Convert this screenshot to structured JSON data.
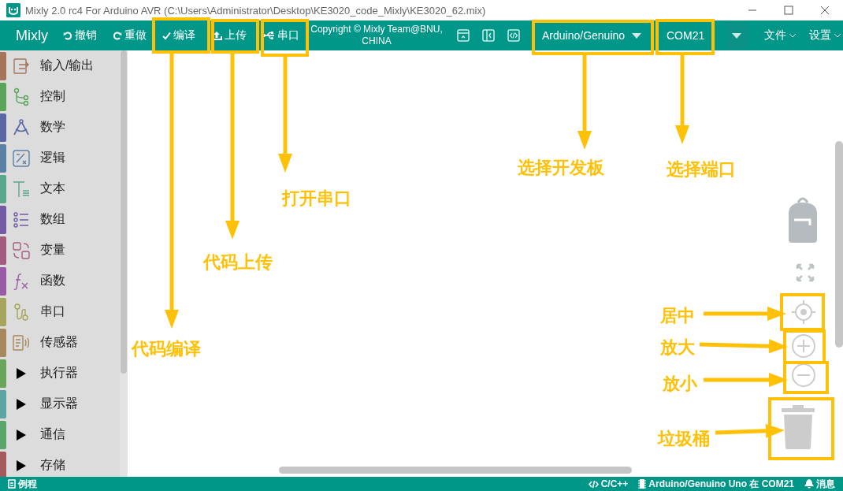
{
  "window": {
    "title": "Mixly 2.0 rc4 For Arduino AVR (C:\\Users\\Administrator\\Desktop\\KE3020_code_Mixly\\KE3020_62.mix)"
  },
  "toolbar": {
    "logo": "Mixly",
    "buttons": [
      {
        "label": "撤销",
        "kind": "undo"
      },
      {
        "label": "重做",
        "kind": "redo"
      },
      {
        "label": "编译",
        "kind": "compile"
      },
      {
        "label": "上传",
        "kind": "upload"
      },
      {
        "label": "串口",
        "kind": "serial"
      }
    ],
    "copyright": "Copyright © Mixly Team@BNU, CHINA",
    "board_select": {
      "value": "Arduino/Genuino"
    },
    "port_select": {
      "value": "COM21"
    },
    "menus": [
      {
        "label": "文件"
      },
      {
        "label": "设置"
      }
    ]
  },
  "sidebar": {
    "items": [
      {
        "label": "输入/输出",
        "kind": "icon",
        "color": "#a5745b"
      },
      {
        "label": "控制",
        "kind": "icon",
        "color": "#5ba55b"
      },
      {
        "label": "数学",
        "kind": "icon",
        "color": "#5b67a5"
      },
      {
        "label": "逻辑",
        "kind": "icon",
        "color": "#5b80a5"
      },
      {
        "label": "文本",
        "kind": "icon",
        "color": "#5ba58c"
      },
      {
        "label": "数组",
        "kind": "icon",
        "color": "#745ba5"
      },
      {
        "label": "变量",
        "kind": "icon",
        "color": "#a55b80"
      },
      {
        "label": "函数",
        "kind": "icon",
        "color": "#995ba5"
      },
      {
        "label": "串口",
        "kind": "icon",
        "color": "#a5a55b"
      },
      {
        "label": "传感器",
        "kind": "icon",
        "color": "#a5885b"
      },
      {
        "label": "执行器",
        "kind": "folder",
        "color": "#6aa55b"
      },
      {
        "label": "显示器",
        "kind": "folder",
        "color": "#5ba5a5"
      },
      {
        "label": "通信",
        "kind": "folder",
        "color": "#5ba56a"
      },
      {
        "label": "存储",
        "kind": "folder",
        "color": "#a55b5b"
      }
    ]
  },
  "status_bar": {
    "left": {
      "label": "例程"
    },
    "items": [
      {
        "label": "C/C++",
        "kind": "code"
      },
      {
        "label": "Arduino/Genuino Uno 在 COM21",
        "kind": "board"
      },
      {
        "label": "消息",
        "kind": "message"
      }
    ]
  },
  "callouts": [
    {
      "text": "选择开发板"
    },
    {
      "text": "选择端口"
    },
    {
      "text": "打开串口"
    },
    {
      "text": "代码上传"
    },
    {
      "text": "居中"
    },
    {
      "text": "放大"
    },
    {
      "text": "代码编译"
    },
    {
      "text": "放小"
    },
    {
      "text": "垃圾桶"
    }
  ]
}
